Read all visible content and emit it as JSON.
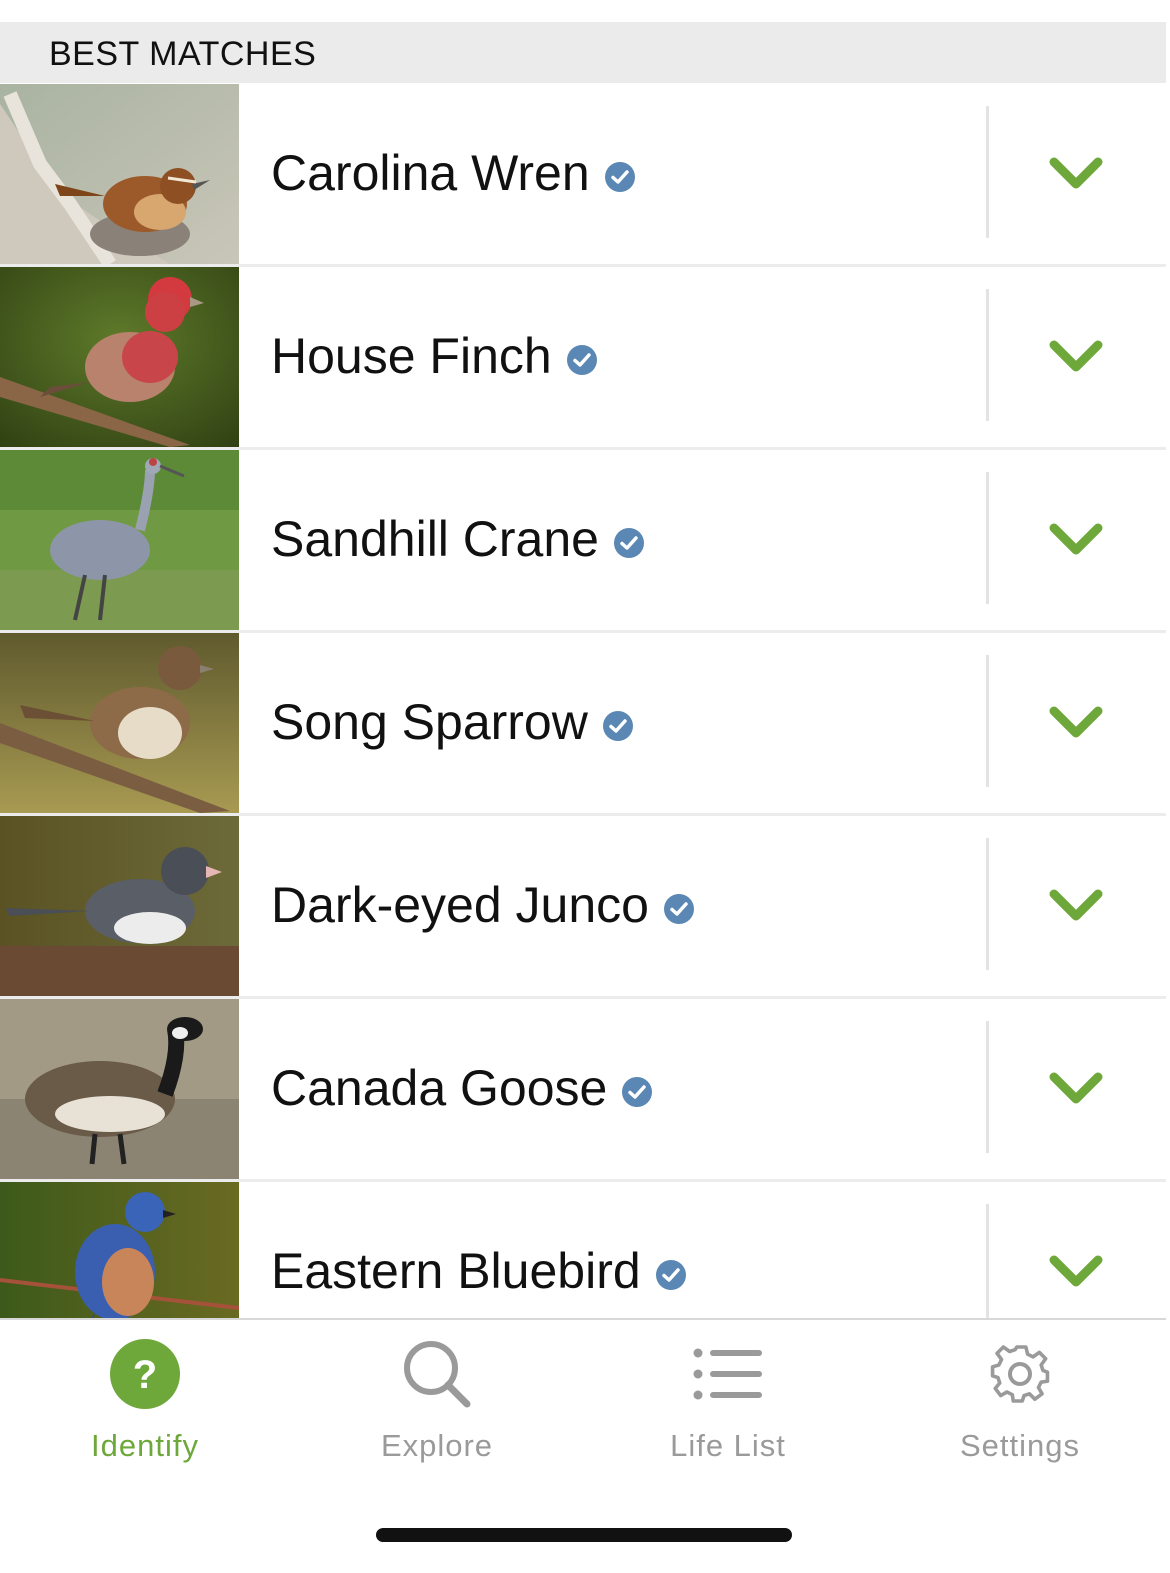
{
  "section": {
    "title": "BEST MATCHES"
  },
  "birds": [
    {
      "name": "Carolina Wren",
      "icon": "verified-check-icon"
    },
    {
      "name": "House Finch",
      "icon": "verified-check-icon"
    },
    {
      "name": "Sandhill Crane",
      "icon": "verified-check-icon"
    },
    {
      "name": "Song Sparrow",
      "icon": "verified-check-icon"
    },
    {
      "name": "Dark-eyed Junco",
      "icon": "verified-check-icon"
    },
    {
      "name": "Canada Goose",
      "icon": "verified-check-icon"
    },
    {
      "name": "Eastern Bluebird",
      "icon": "verified-check-icon"
    }
  ],
  "tabs": [
    {
      "label": "Identify",
      "icon": "question-icon",
      "active": true
    },
    {
      "label": "Explore",
      "icon": "search-icon",
      "active": false
    },
    {
      "label": "Life List",
      "icon": "list-icon",
      "active": false
    },
    {
      "label": "Settings",
      "icon": "gear-icon",
      "active": false
    }
  ],
  "colors": {
    "accent_green": "#6ea83b",
    "verified_blue": "#5a87b3",
    "tab_inactive": "#9a9a9a",
    "header_bg": "#ebebeb"
  }
}
